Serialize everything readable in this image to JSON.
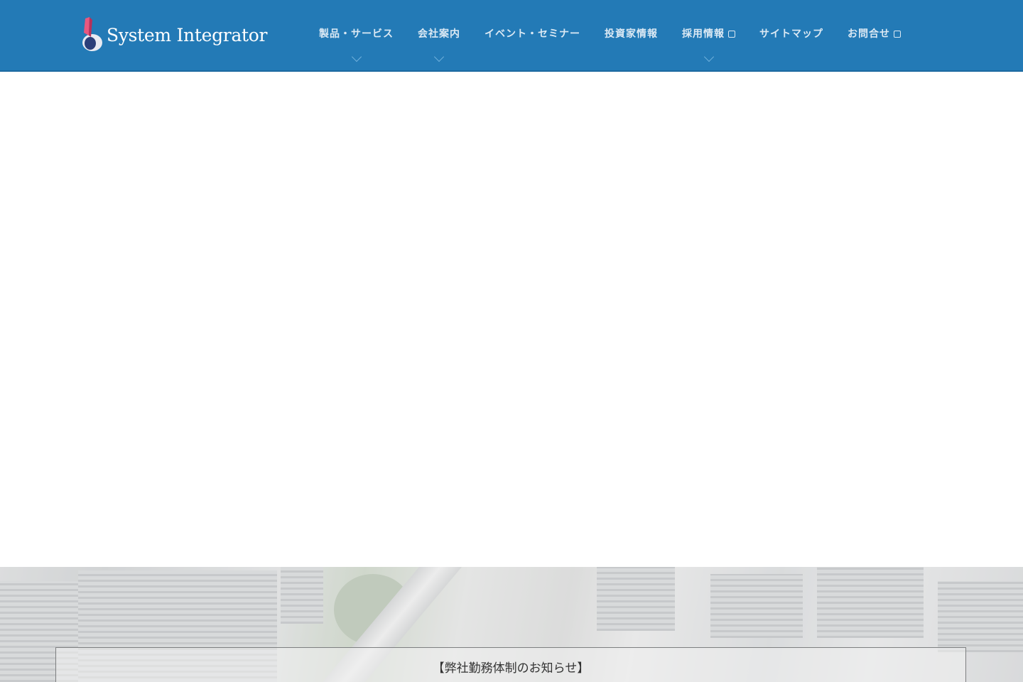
{
  "header": {
    "logo_text": "System Integrator",
    "nav": [
      {
        "label": "製品・サービス",
        "dropdown": true,
        "external": false
      },
      {
        "label": "会社案内",
        "dropdown": true,
        "external": false
      },
      {
        "label": "イベント・セミナー",
        "dropdown": false,
        "external": false
      },
      {
        "label": "投資家情報",
        "dropdown": false,
        "external": false
      },
      {
        "label": "採用情報",
        "dropdown": true,
        "external": true
      },
      {
        "label": "サイトマップ",
        "dropdown": false,
        "external": false
      },
      {
        "label": "お問合せ",
        "dropdown": false,
        "external": true
      }
    ]
  },
  "notice": {
    "title": "【弊社勤務体制のお知らせ】"
  },
  "colors": {
    "header": "#237ab6"
  }
}
